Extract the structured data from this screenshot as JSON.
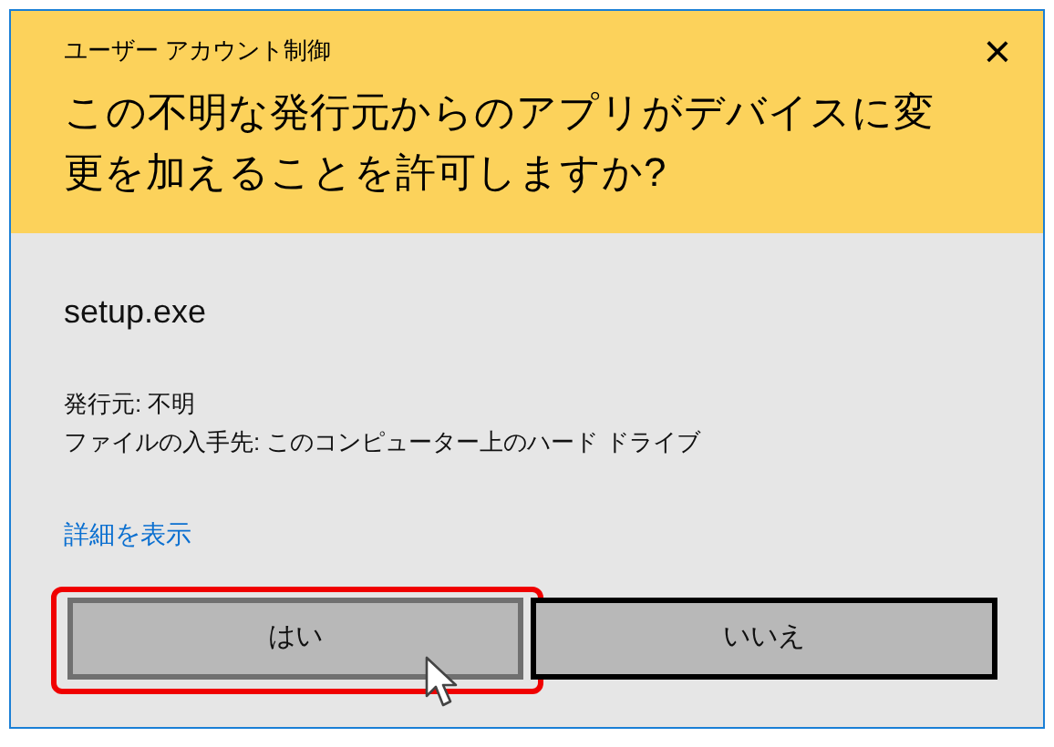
{
  "window": {
    "title": "ユーザー アカウント制御",
    "close": "×"
  },
  "question": "この不明な発行元からのアプリがデバイスに変更を加えることを許可しますか?",
  "program": "setup.exe",
  "details": [
    "発行元: 不明",
    "ファイルの入手先: このコンピューター上のハード ドライブ"
  ],
  "link": "詳細を表示",
  "buttons": [
    {
      "label": "はい",
      "focused": false,
      "highlighted": true
    },
    {
      "label": "いいえ",
      "focused": true,
      "highlighted": false
    }
  ]
}
